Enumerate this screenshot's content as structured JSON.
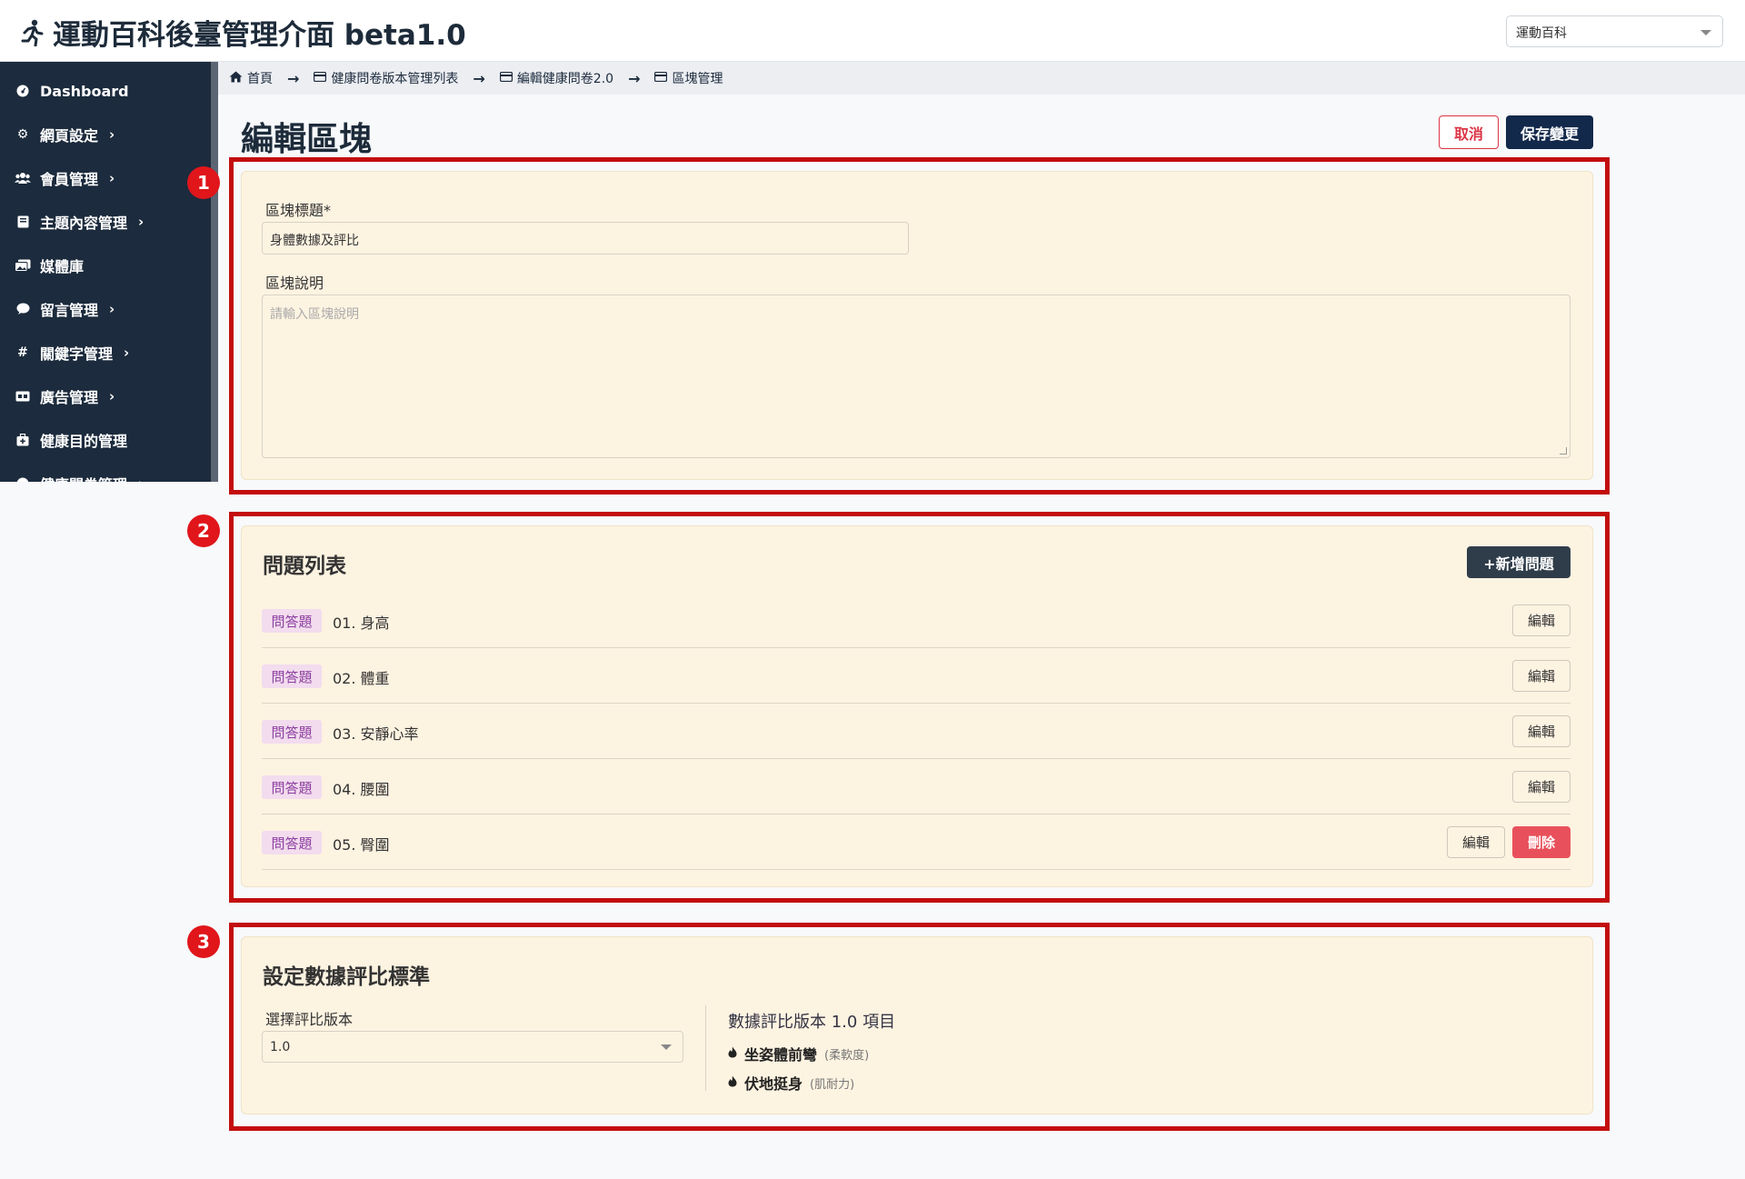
{
  "header": {
    "title": "運動百科後臺管理介面 beta1.0",
    "site_select": "運動百科"
  },
  "sidebar": {
    "items": [
      {
        "label": "Dashboard",
        "icon": "dashboard-icon",
        "chevron": false
      },
      {
        "label": "網頁設定",
        "icon": "gear-icon",
        "chevron": true
      },
      {
        "label": "會員管理",
        "icon": "users-icon",
        "chevron": true
      },
      {
        "label": "主題內容管理",
        "icon": "book-icon",
        "chevron": true
      },
      {
        "label": "媒體庫",
        "icon": "images-icon",
        "chevron": false
      },
      {
        "label": "留言管理",
        "icon": "comment-icon",
        "chevron": true
      },
      {
        "label": "關鍵字管理",
        "icon": "hashtag-icon",
        "chevron": true
      },
      {
        "label": "廣告管理",
        "icon": "ad-icon",
        "chevron": true
      },
      {
        "label": "健康目的管理",
        "icon": "briefcase-medical-icon",
        "chevron": false
      },
      {
        "label": "健康問卷管理",
        "icon": "circle-icon",
        "chevron": true
      }
    ]
  },
  "breadcrumb": {
    "items": [
      "首頁",
      "健康問卷版本管理列表",
      "編輯健康問卷2.0",
      "區塊管理"
    ],
    "separator": "→"
  },
  "page": {
    "title": "編輯區塊",
    "cancel_label": "取消",
    "save_label": "保存變更"
  },
  "markers": [
    "1",
    "2",
    "3"
  ],
  "block_form": {
    "title_label": "區塊標題*",
    "title_value": "身體數據及評比",
    "description_label": "區塊說明",
    "description_placeholder": "請輸入區塊說明"
  },
  "questions": {
    "title": "問題列表",
    "add_label": "+新增問題",
    "edit_label": "編輯",
    "delete_label": "刪除",
    "rows": [
      {
        "type": "問答題",
        "text": "01. 身高"
      },
      {
        "type": "問答題",
        "text": "02. 體重"
      },
      {
        "type": "問答題",
        "text": "03. 安靜心率"
      },
      {
        "type": "問答題",
        "text": "04. 腰圍"
      },
      {
        "type": "問答題",
        "text": "05. 臀圍"
      }
    ]
  },
  "evaluation": {
    "title": "設定數據評比標準",
    "version_label": "選擇評比版本",
    "version_value": "1.0",
    "items_title": "數據評比版本 1.0 項目",
    "items": [
      {
        "name": "坐姿體前彎",
        "category": "(柔軟度)"
      },
      {
        "name": "伏地挺身",
        "category": "(肌耐力)"
      }
    ]
  },
  "colors": {
    "sidebar_bg": "#1c2b3d",
    "card_bg": "#fdf3e1",
    "highlight": "#c30d0d",
    "primary": "#13294b",
    "danger": "#e8515b",
    "badge_text": "#8d3fa0"
  }
}
